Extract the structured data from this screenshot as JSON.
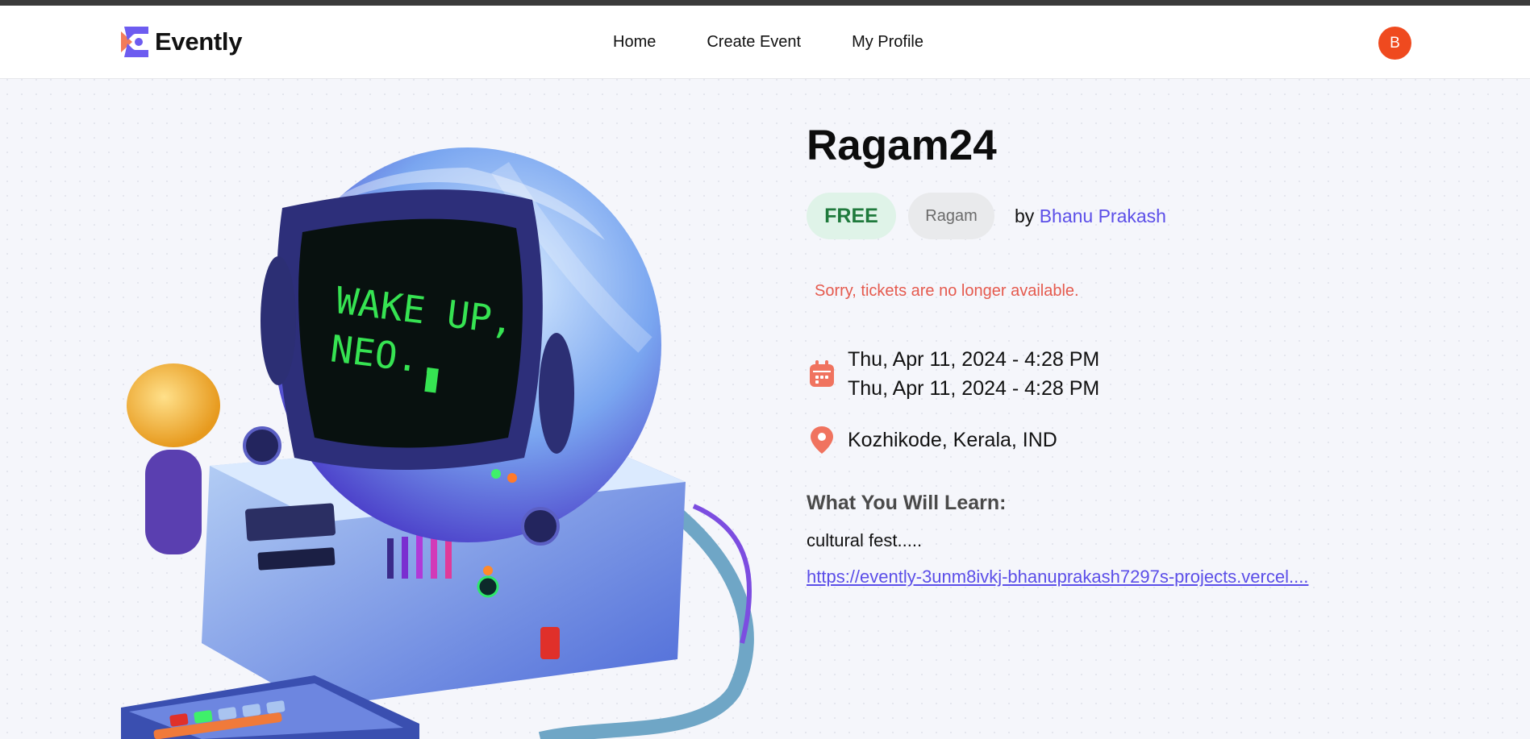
{
  "header": {
    "logo_text": "Evently",
    "nav": [
      "Home",
      "Create Event",
      "My Profile"
    ],
    "avatar_initial": "B"
  },
  "event": {
    "title": "Ragam24",
    "price_badge": "FREE",
    "category": "Ragam",
    "by_prefix": "by",
    "organizer": "Bhanu Prakash",
    "availability_message": "Sorry, tickets are no longer available.",
    "start_datetime": "Thu, Apr 11, 2024 - 4:28 PM",
    "end_datetime": "Thu, Apr 11, 2024 - 4:28 PM",
    "location": "Kozhikode, Kerala, IND",
    "learn_heading": "What You Will Learn:",
    "description": "cultural fest.....",
    "url": "https://evently-3unm8ivkj-bhanuprakash7297s-projects.vercel...."
  },
  "image": {
    "screen_text_line1": "WAKE UP,",
    "screen_text_line2": "NEO.."
  },
  "colors": {
    "accent": "#5b4ee8",
    "avatar": "#ef4a1f",
    "free_text": "#1f7a3c",
    "free_bg": "#dff3e8",
    "error": "#e55a4e",
    "icon": "#f0735f"
  },
  "icons": [
    "evently-logo-icon",
    "calendar-icon",
    "location-pin-icon"
  ]
}
